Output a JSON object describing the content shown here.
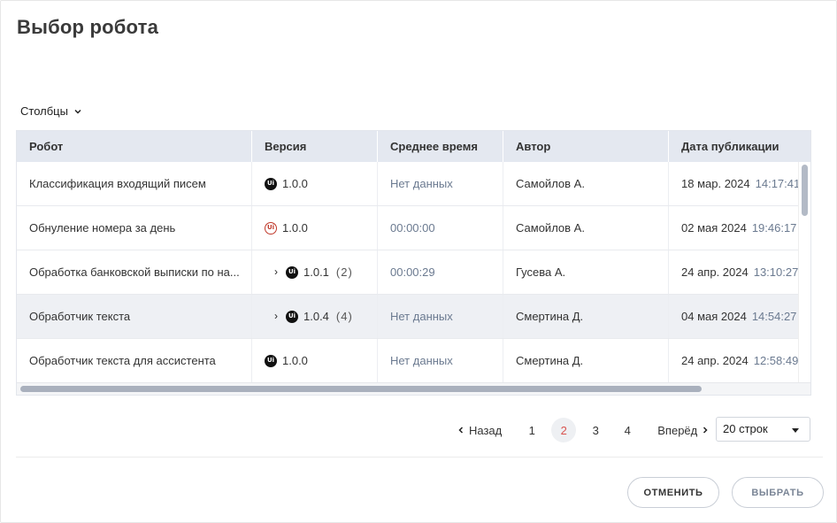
{
  "dialog": {
    "title": "Выбор робота",
    "columns_toggle": "Столбцы"
  },
  "table": {
    "headers": [
      "Робот",
      "Версия",
      "Среднее время",
      "Автор",
      "Дата публикации"
    ],
    "rows": [
      {
        "robot": "Классификация входящий писем",
        "expandable": false,
        "icon": "ui-dark-icon",
        "version": "1.0.0",
        "count": "",
        "avg_time": "Нет данных",
        "author": "Самойлов А.",
        "date": "18 мар. 2024",
        "time": "14:17:41"
      },
      {
        "robot": "Обнуление номера за день",
        "expandable": false,
        "icon": "ui-red-icon",
        "version": "1.0.0",
        "count": "",
        "avg_time": "00:00:00",
        "author": "Самойлов А.",
        "date": "02 мая 2024",
        "time": "19:46:17"
      },
      {
        "robot": "Обработка банковской выписки по на...",
        "expandable": true,
        "icon": "ui-dark-icon",
        "version": "1.0.1",
        "count": "(2)",
        "avg_time": "00:00:29",
        "author": "Гусева А.",
        "date": "24 апр. 2024",
        "time": "13:10:27"
      },
      {
        "robot": "Обработчик текста",
        "expandable": true,
        "icon": "ui-dark-icon",
        "version": "1.0.4",
        "count": "(4)",
        "avg_time": "Нет данных",
        "author": "Смертина Д.",
        "date": "04 мая 2024",
        "time": "14:54:27"
      },
      {
        "robot": "Обработчик текста для ассистента",
        "expandable": false,
        "icon": "ui-dark-icon",
        "version": "1.0.0",
        "count": "",
        "avg_time": "Нет данных",
        "author": "Смертина Д.",
        "date": "24 апр. 2024",
        "time": "12:58:49"
      }
    ],
    "selected_row": 3
  },
  "pagination": {
    "prev_label": "Назад",
    "next_label": "Вперёд",
    "pages": [
      "1",
      "2",
      "3",
      "4"
    ],
    "current": "2",
    "rows_per_page": "20 строк"
  },
  "footer": {
    "cancel_label": "ОТМЕНИТЬ",
    "select_label": "ВЫБРАТЬ"
  },
  "colors": {
    "accent_active_page": "#d9534f",
    "header_bg": "#e4e8f0",
    "muted_text": "#6b7a90"
  }
}
